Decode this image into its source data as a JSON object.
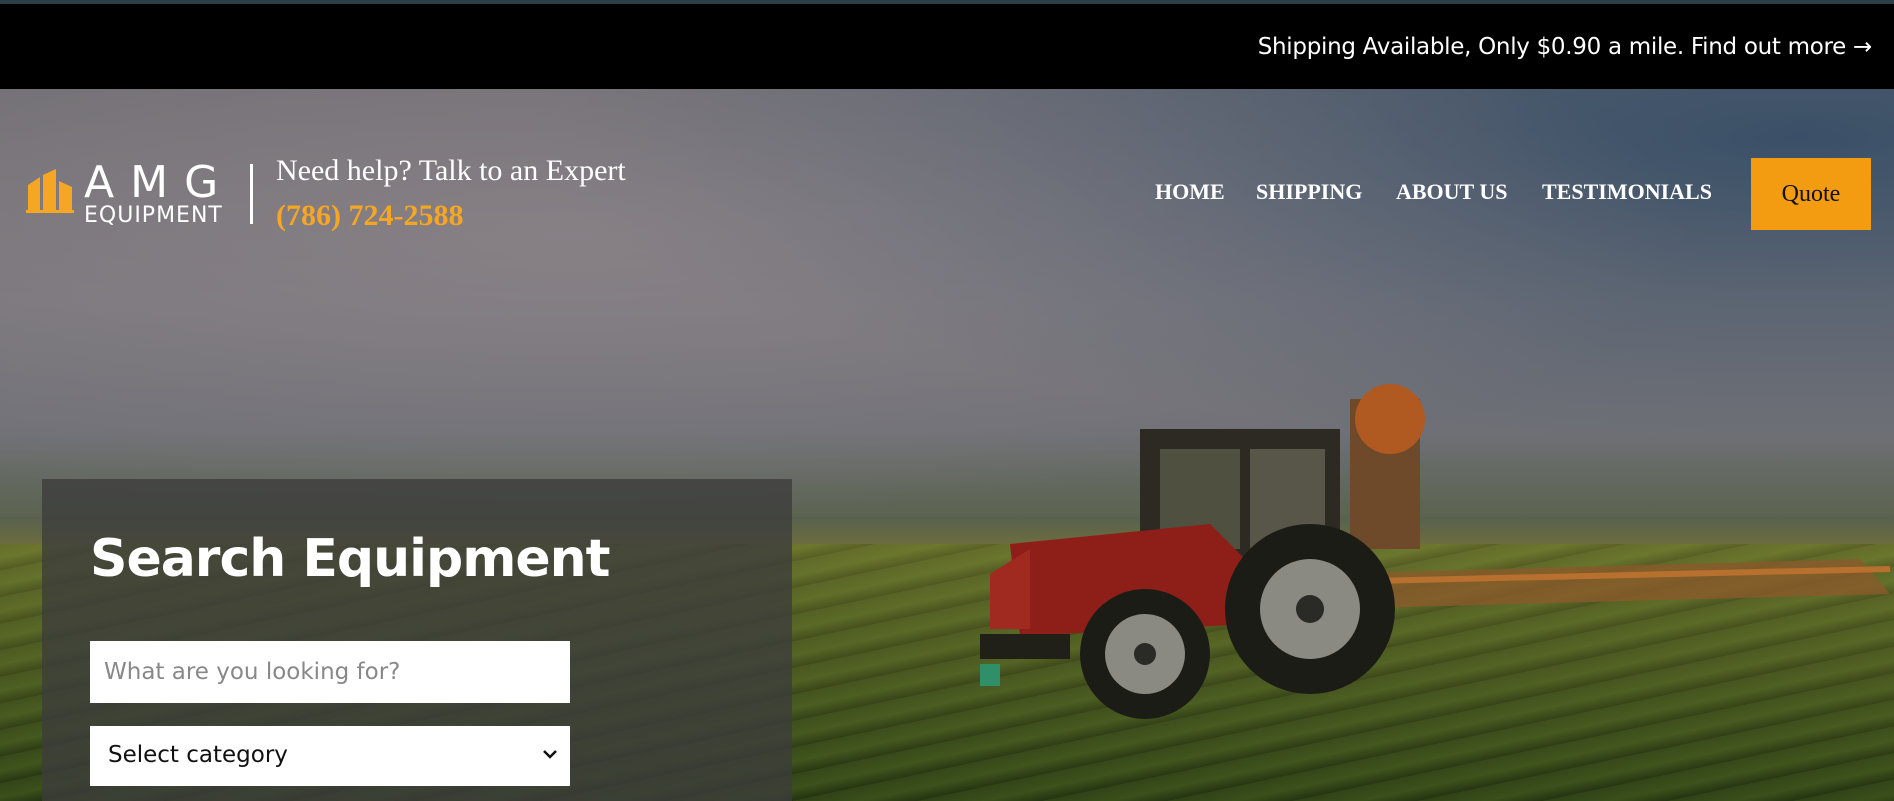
{
  "announcement": {
    "text": "Shipping Available, Only $0.90 a mile. Find out more →"
  },
  "logo": {
    "wordmark": "AMG",
    "subtitle": "EQUIPMENT",
    "icon": "buildings-icon"
  },
  "contact": {
    "help_text": "Need help? Talk to an Expert",
    "phone": "(786) 724-2588"
  },
  "nav": {
    "items": [
      {
        "label": "HOME"
      },
      {
        "label": "SHIPPING"
      },
      {
        "label": "ABOUT US"
      },
      {
        "label": "TESTIMONIALS"
      }
    ]
  },
  "quote_button": {
    "label": "Quote"
  },
  "search": {
    "title": "Search Equipment",
    "input_placeholder": "What are you looking for?",
    "category_value": "Select category",
    "chevron_icon": "chevron-down-icon"
  },
  "colors": {
    "accent": "#f5a623",
    "quote_bg": "#f39c12",
    "topbar_bg": "#000000"
  }
}
